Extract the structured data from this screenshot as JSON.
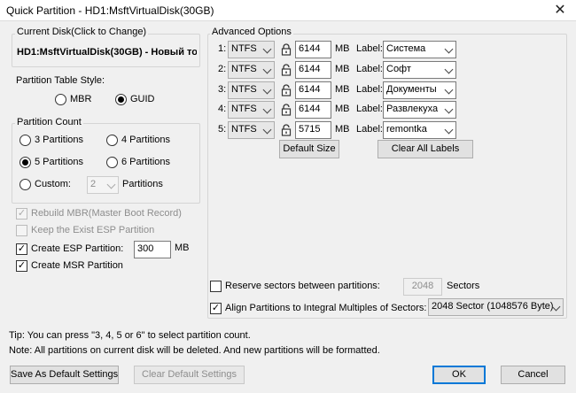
{
  "window": {
    "title": "Quick Partition - HD1:MsftVirtualDisk(30GB)",
    "close_glyph": "✕"
  },
  "current_disk": {
    "legend": "Current Disk(Click to Change)",
    "value": "HD1:MsftVirtualDisk(30GB) - Новый то"
  },
  "table_style": {
    "label": "Partition Table Style:",
    "mbr": "MBR",
    "guid": "GUID",
    "selected": "GUID"
  },
  "partition_count": {
    "legend": "Partition Count",
    "options": [
      "3 Partitions",
      "4 Partitions",
      "5 Partitions",
      "6 Partitions"
    ],
    "custom_label": "Custom:",
    "custom_value": "2",
    "partitions_suffix": "Partitions",
    "selected": "5 Partitions"
  },
  "options": {
    "rebuild_mbr": {
      "label": "Rebuild MBR(Master Boot Record)",
      "checked": true,
      "enabled": false
    },
    "keep_esp": {
      "label": "Keep the Exist ESP Partition",
      "checked": false,
      "enabled": false
    },
    "create_esp": {
      "label": "Create ESP Partition:",
      "checked": true,
      "size": "300",
      "unit": "MB"
    },
    "create_msr": {
      "label": "Create MSR Partition",
      "checked": true
    }
  },
  "advanced": {
    "legend": "Advanced Options",
    "size_unit": "MB",
    "label_caption": "Label:",
    "partitions": [
      {
        "index": "1:",
        "fs": "NTFS",
        "size": "6144",
        "label": "Система",
        "locked": true
      },
      {
        "index": "2:",
        "fs": "NTFS",
        "size": "6144",
        "label": "Софт",
        "locked": false
      },
      {
        "index": "3:",
        "fs": "NTFS",
        "size": "6144",
        "label": "Документы",
        "locked": false
      },
      {
        "index": "4:",
        "fs": "NTFS",
        "size": "6144",
        "label": "Развлекуха",
        "locked": false
      },
      {
        "index": "5:",
        "fs": "NTFS",
        "size": "5715",
        "label": "remontka",
        "locked": false
      }
    ],
    "default_size_button": "Default Size",
    "clear_labels_button": "Clear All Labels",
    "reserve": {
      "label": "Reserve sectors between partitions:",
      "value": "2048",
      "unit": "Sectors",
      "checked": false
    },
    "align": {
      "label": "Align Partitions to Integral Multiples of Sectors:",
      "value": "2048 Sector (1048576 Byte)",
      "checked": true
    }
  },
  "tips": {
    "tip": "Tip:  You can press \"3, 4, 5 or 6\" to select partition count.",
    "note": "Note: All partitions on current disk will be deleted. And new partitions will be formatted."
  },
  "buttons": {
    "save_default": "Save As Default Settings",
    "clear_default": "Clear Default Settings",
    "ok": "OK",
    "cancel": "Cancel"
  }
}
